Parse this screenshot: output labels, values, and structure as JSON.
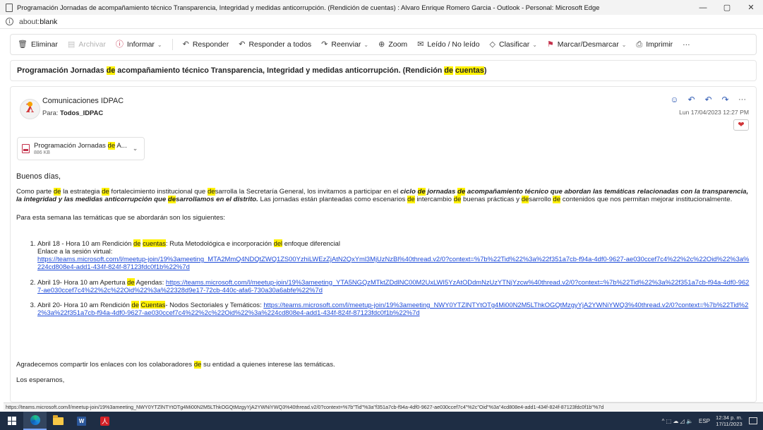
{
  "window": {
    "title": "Programación Jornadas de acompañamiento técnico Transparencia, Integridad y medidas anticorrupción. (Rendición de cuentas) : Alvaro Enrique Romero Garcia - Outlook - Personal: Microsoft Edge",
    "controls": {
      "minimize": "—",
      "restore": "▢",
      "close": "✕"
    }
  },
  "address": {
    "prefix": "about:",
    "host": "blank",
    "info_icon": "i"
  },
  "toolbar": {
    "delete": "Eliminar",
    "archive": "Archivar",
    "report": "Informar",
    "reply": "Responder",
    "reply_all": "Responder a todos",
    "forward": "Reenviar",
    "zoom": "Zoom",
    "read_unread": "Leído / No leído",
    "categorize": "Clasificar",
    "flag": "Marcar/Desmarcar",
    "print": "Imprimir",
    "more": "···"
  },
  "subject": {
    "p1": "Programación Jornadas ",
    "h1": "de",
    "p2": " acompañamiento técnico Transparencia, Integridad y medidas anticorrupción. (Rendición ",
    "h2": "de",
    "p3": " ",
    "h3": "cuentas",
    "p4": ")"
  },
  "message": {
    "sender": "Comunicaciones IDPAC",
    "to_label": "Para:",
    "to_value": "Todos_IDPAC",
    "date": "Lun 17/04/2023 12:27 PM",
    "reaction": "❤"
  },
  "attachment": {
    "name_prefix": "Programación Jornadas ",
    "name_hl": "de",
    "name_suffix": " A...",
    "size": "886 KB"
  },
  "body": {
    "greeting": "Buenos días,",
    "para1": {
      "t1": "Como parte ",
      "h1": "de",
      "t2": " la estrategia ",
      "h2": "de",
      "t3": " fortalecimiento institucional que ",
      "h3": "de",
      "t4": "sarrolla la Secretaría General, los invitamos a participar en el ",
      "b1": "ciclo ",
      "bh1": "de",
      "b2": " jornadas ",
      "bh2": "de",
      "b3": " acompañamiento técnico que abordan las temáticas relacionadas con la transparencia, la integridad y las medidas anticorrupción que ",
      "bh3": "de",
      "b4": "sarrollamos en el distrito.",
      "t5": " Las jornadas están planteadas como escenarios ",
      "h4": "de",
      "t6": " intercambio ",
      "h5": "de",
      "t7": " buenas prácticas y ",
      "h6": "de",
      "t8": "sarrollo ",
      "h7": "de",
      "t9": " contenidos que nos permitan mejorar institucionalmente."
    },
    "para2": "Para esta semana las temáticas que se abordarán son los siguientes:",
    "items": [
      {
        "a": "Abril 18 - Hora 10 am Rendición ",
        "ha": "de",
        "b": " ",
        "hb": "cuentas",
        "c": ": Ruta Metodológica e incorporación ",
        "hc": "del",
        "d": " enfoque diferencial",
        "e": "Enlace a la sesión virtual:",
        "link": "https://teams.microsoft.com/l/meetup-join/19%3ameeting_MTA2MmQ4NDQtZWQ1ZS00YzhiLWEzZjAtN2QxYml3MjUzNzBl%40thread.v2/0?context=%7b%22Tid%22%3a%22f351a7cb-f94a-4df0-9627-ae030ccef7c4%22%2c%22Oid%22%3a%224cd808e4-add1-434f-824f-87123fdc0f1b%22%7d"
      },
      {
        "a": "Abril 19- Hora 10 am Apertura ",
        "ha": "de",
        "b": " Agendas: ",
        "link": "https://teams.microsoft.com/l/meetup-join/19%3ameeting_YTA5NGQzMTktZDdlNC00M2UxLWI5YzAtODdmNzUzYTNjYzcw%40thread.v2/0?context=%7b%22Tid%22%3a%22f351a7cb-f94a-4df0-9627-ae030ccef7c4%22%2c%22Oid%22%3a%22328d9e17-72cb-440c-afa6-730a30a6abfe%22%7d"
      },
      {
        "a": "Abril 20- Hora 10 am Rendición ",
        "ha": "de",
        "b": " ",
        "hb": "Cuentas",
        "c": "- Nodos Sectoriales y Temáticos: ",
        "link": "https://teams.microsoft.com/l/meetup-join/19%3ameeting_NWY0YTZlNTYtOTg4Mi00N2M5LThkOGQtMzgyYjA2YWNiYWQ3%40thread.v2/0?context=%7b%22Tid%22%3a%22f351a7cb-f94a-4df0-9627-ae030ccef7c4%22%2c%22Oid%22%3a%224cd808e4-add1-434f-824f-87123fdc0f1b%22%7d"
      }
    ],
    "thanks_a": "Agradecemos compartir los enlaces con los colaboradores ",
    "thanks_h": "de",
    "thanks_b": " su entidad a quienes interese las temáticas.",
    "closing": "Los esperamos,"
  },
  "statusbar": "https://teams.microsoft.com/l/meetup-join/19%3ameeting_NWY0YTZlNTYtOTg4Mi00N2M5LThkOGQtMzgyYjA2YWNiYWQ3%40thread.v2/0?context=%7b\"Tid\"%3a\"f351a7cb-f94a-4df0-9627-ae030ccef7c4\"%2c\"Oid\"%3a\"4cd808e4-add1-434f-824f-87123fdc0f1b\"%7d",
  "taskbar": {
    "word_letter": "W",
    "acrobat_letter": "人",
    "tray_icons": "^  ⬚  ☁  ◿  🔈",
    "lang": "ESP",
    "time": "12:34 p. m.",
    "date": "17/11/2023"
  },
  "colors": {
    "highlight": "#fff100",
    "link": "#1f4cd9",
    "accent": "#2f5ab4",
    "taskbar": "#1e2d44"
  }
}
